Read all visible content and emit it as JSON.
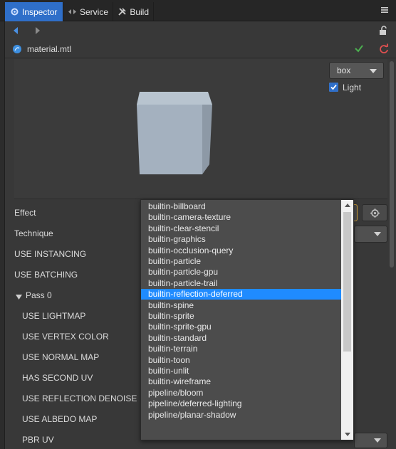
{
  "tabs": [
    {
      "label": "Inspector",
      "icon": "gear-icon",
      "active": true
    },
    {
      "label": "Service",
      "icon": "service-icon",
      "active": false
    },
    {
      "label": "Build",
      "icon": "build-icon",
      "active": false
    }
  ],
  "file": {
    "name": "material.mtl",
    "icon": "material-icon"
  },
  "preview": {
    "shape": "box",
    "light_label": "Light",
    "light_checked": true
  },
  "properties": {
    "effect_label": "Effect",
    "effect_value": "builtin-reflection-deferred",
    "technique_label": "Technique",
    "use_instancing": "USE INSTANCING",
    "use_batching": "USE BATCHING",
    "pass_label": "Pass 0",
    "use_lightmap": "USE LIGHTMAP",
    "use_vertex_color": "USE VERTEX COLOR",
    "use_normal_map": "USE NORMAL MAP",
    "has_second_uv": "HAS SECOND UV",
    "use_reflection_denoise": "USE REFLECTION DENOISE",
    "use_albedo_map": "USE ALBEDO MAP",
    "pbr_uv": "PBR UV"
  },
  "dropdown": {
    "items": [
      "builtin-billboard",
      "builtin-camera-texture",
      "builtin-clear-stencil",
      "builtin-graphics",
      "builtin-occlusion-query",
      "builtin-particle",
      "builtin-particle-gpu",
      "builtin-particle-trail",
      "builtin-reflection-deferred",
      "builtin-spine",
      "builtin-sprite",
      "builtin-sprite-gpu",
      "builtin-standard",
      "builtin-terrain",
      "builtin-toon",
      "builtin-unlit",
      "builtin-wireframe",
      "pipeline/bloom",
      "pipeline/deferred-lighting",
      "pipeline/planar-shadow"
    ],
    "selected": "builtin-reflection-deferred"
  },
  "colors": {
    "accent": "#2f6fc9",
    "selection": "#1f8bff",
    "focus_border": "#c79a3a",
    "confirm": "#4caf50",
    "revert": "#e05050"
  }
}
